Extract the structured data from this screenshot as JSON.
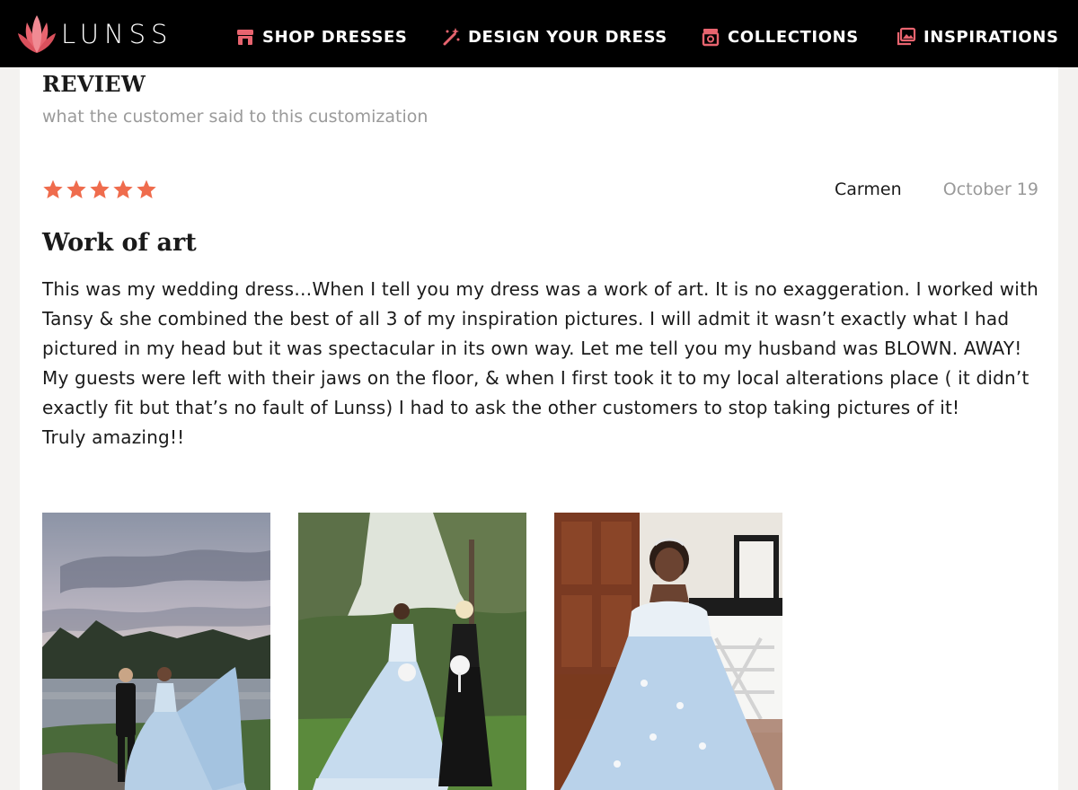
{
  "brand": {
    "name": "LUNSS",
    "accent": "#e8646f"
  },
  "nav": {
    "items": [
      {
        "label": "SHOP DRESSES",
        "icon": "store-icon"
      },
      {
        "label": "DESIGN YOUR DRESS",
        "icon": "magic-wand-icon"
      },
      {
        "label": "COLLECTIONS",
        "icon": "box-icon"
      },
      {
        "label": "INSPIRATIONS",
        "icon": "images-icon"
      }
    ]
  },
  "review_section": {
    "title": "REVIEW",
    "subtitle": "what the customer said to this customization"
  },
  "review": {
    "rating": 5,
    "rating_max": 5,
    "star_color": "#ef6c4d",
    "author": "Carmen",
    "date": "October 19",
    "title": "Work of art",
    "body": "This was my wedding dress…When I tell you my dress was a work of art. It is no exaggeration. I worked with Tansy & she combined the best of all 3 of my inspiration pictures. I will admit it wasn’t exactly what I had pictured in my head but it was spectacular in its own way. Let me tell you my husband was BLOWN. AWAY! My guests were left with their jaws on the floor, & when I first took it to my local alterations place ( it didn’t exactly fit but that’s no fault of Lunss) I had to ask the other customers to stop taking pictures of it!",
    "body_closing": "Truly amazing!!",
    "photos": [
      {
        "alt": "bride-and-groom-photo"
      },
      {
        "alt": "bride-and-bridesmaid-photo"
      },
      {
        "alt": "bride-seated-photo"
      }
    ]
  }
}
